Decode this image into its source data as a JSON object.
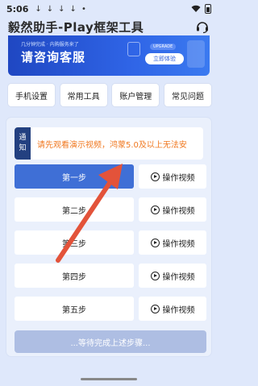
{
  "status": {
    "time": "5:06",
    "download_icons": [
      "↓",
      "↓",
      "↓",
      "↓"
    ],
    "dot": "•"
  },
  "header": {
    "title": "毅然助手-Play框架工具",
    "support_icon": "headset-icon"
  },
  "banner": {
    "small_text": "几分钟完成 · 内购服务来了",
    "main_text": "请咨询客服",
    "tag_text": "UPGRADE",
    "button_label": "立即体验"
  },
  "toolbar": {
    "items": [
      "手机设置",
      "常用工具",
      "账户管理",
      "常见问题"
    ]
  },
  "notice": {
    "label_line1": "通",
    "label_line2": "知",
    "text": "请先观看演示视频，鸿蒙5.0及以上无法安"
  },
  "steps": [
    {
      "label": "第一步",
      "video_label": "操作视频",
      "active": true
    },
    {
      "label": "第二步",
      "video_label": "操作视频",
      "active": false
    },
    {
      "label": "第三步",
      "video_label": "操作视频",
      "active": false
    },
    {
      "label": "第四步",
      "video_label": "操作视频",
      "active": false
    },
    {
      "label": "第五步",
      "video_label": "操作视频",
      "active": false
    }
  ],
  "wait_text": "...等待完成上述步骤...",
  "colors": {
    "accent": "#3f6fd6",
    "notice_text": "#f07820",
    "arrow": "#e3533a",
    "background": "#dfe8fb"
  }
}
